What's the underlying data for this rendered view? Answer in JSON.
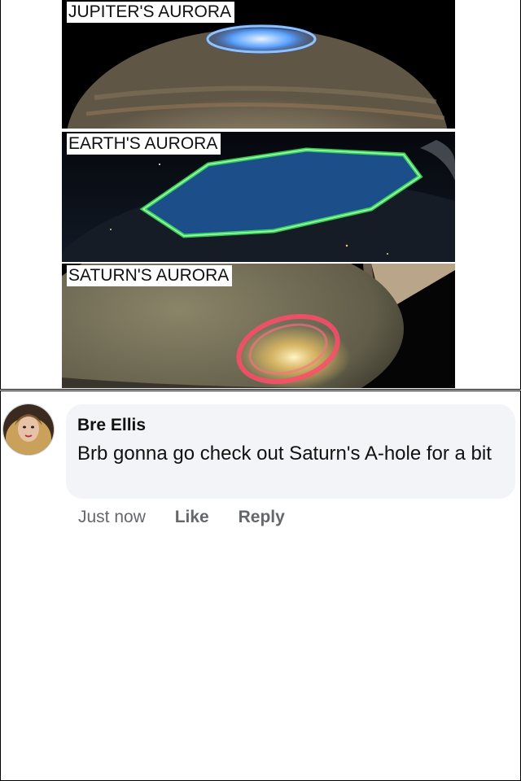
{
  "panels": [
    {
      "label": "JUPITER'S AURORA"
    },
    {
      "label": "EARTH'S AURORA"
    },
    {
      "label": "SATURN'S AURORA"
    }
  ],
  "comment": {
    "author": "Bre Ellis",
    "text": "Brb gonna go check out Saturn's A-hole for a bit",
    "timestamp": "Just now",
    "like_label": "Like",
    "reply_label": "Reply"
  }
}
